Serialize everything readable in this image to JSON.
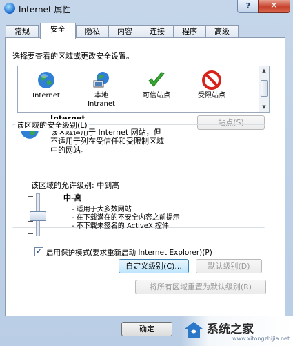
{
  "window": {
    "title": "Internet 属性",
    "help_label": "?",
    "close_label": "✕"
  },
  "tabs": [
    "常规",
    "安全",
    "隐私",
    "内容",
    "连接",
    "程序",
    "高级"
  ],
  "active_tab": "安全",
  "security": {
    "zones_prompt": "选择要查看的区域或更改安全设置。",
    "zones": [
      {
        "label_line1": "Internet",
        "label_line2": "",
        "icon": "globe-icon"
      },
      {
        "label_line1": "本地",
        "label_line2": "Intranet",
        "icon": "local-intranet-icon"
      },
      {
        "label_line1": "可信站点",
        "label_line2": "",
        "icon": "checkmark-icon"
      },
      {
        "label_line1": "受限站点",
        "label_line2": "",
        "icon": "no-entry-icon"
      }
    ],
    "selected_zone": {
      "name": "Internet",
      "desc_line1": "该区域适用于 Internet 网站，但",
      "desc_line2": "不适用于列在受信任和受限制区域",
      "desc_line3": "中的网站。"
    },
    "sites_button": "站点(S)",
    "level_group_title": "该区域的安全级别(L)",
    "allowed_levels": "该区域的允许级别: 中到高",
    "level_name": "中-高",
    "level_bullets": [
      "- 适用于大多数网站",
      "- 在下载潜在的不安全内容之前提示",
      "- 不下载未签名的 ActiveX 控件"
    ],
    "protected_mode_label": "启用保护模式(要求重新启动 Internet Explorer)(P)",
    "protected_mode_checked": true,
    "custom_level_button": "自定义级别(C)...",
    "default_level_button": "默认级别(D)",
    "reset_all_button": "将所有区域重置为默认级别(R)"
  },
  "footer": {
    "ok_button": "确定"
  },
  "watermark": {
    "text": "系统之家",
    "url": "www.xitongzhijia.net"
  },
  "colors": {
    "accent": "#1f6fd0",
    "close": "#c7412c"
  }
}
